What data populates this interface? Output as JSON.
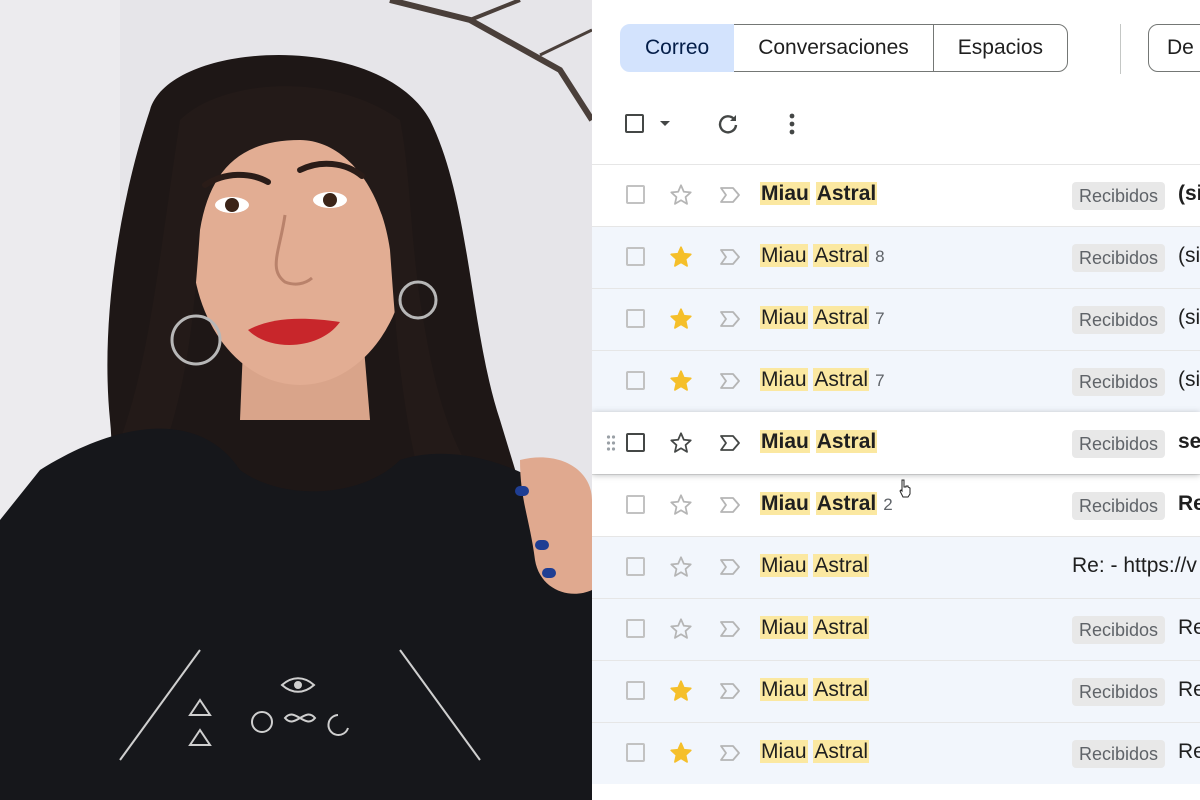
{
  "filters": {
    "tabs": [
      {
        "label": "Correo",
        "selected": true
      },
      {
        "label": "Conversaciones",
        "selected": false
      },
      {
        "label": "Espacios",
        "selected": false
      }
    ],
    "from_label": "De"
  },
  "toolbar": {
    "select_all_icon": "checkbox-icon",
    "select_menu_icon": "caret-down-icon",
    "refresh_icon": "refresh-icon",
    "more_icon": "more-vert-icon"
  },
  "emails": [
    {
      "sender_first": "Miau",
      "sender_second": "Astral",
      "count": "",
      "label": "Recibidos",
      "subject": "(si",
      "starred": false,
      "unread": true
    },
    {
      "sender_first": "Miau",
      "sender_second": "Astral",
      "count": "8",
      "label": "Recibidos",
      "subject": "(si",
      "starred": true,
      "unread": false
    },
    {
      "sender_first": "Miau",
      "sender_second": "Astral",
      "count": "7",
      "label": "Recibidos",
      "subject": "(si",
      "starred": true,
      "unread": false
    },
    {
      "sender_first": "Miau",
      "sender_second": "Astral",
      "count": "7",
      "label": "Recibidos",
      "subject": "(si",
      "starred": true,
      "unread": false
    },
    {
      "sender_first": "Miau",
      "sender_second": "Astral",
      "count": "",
      "label": "Recibidos",
      "subject": "se",
      "starred": false,
      "unread": true,
      "hovered": true
    },
    {
      "sender_first": "Miau",
      "sender_second": "Astral",
      "count": "2",
      "label": "Recibidos",
      "subject": "Re",
      "starred": false,
      "unread": true
    },
    {
      "sender_first": "Miau",
      "sender_second": "Astral",
      "count": "",
      "label": "",
      "subject": "Re: - https://v",
      "starred": false,
      "unread": false
    },
    {
      "sender_first": "Miau",
      "sender_second": "Astral",
      "count": "",
      "label": "Recibidos",
      "subject": "Re",
      "starred": false,
      "unread": false
    },
    {
      "sender_first": "Miau",
      "sender_second": "Astral",
      "count": "",
      "label": "Recibidos",
      "subject": "Re",
      "starred": true,
      "unread": false
    },
    {
      "sender_first": "Miau",
      "sender_second": "Astral",
      "count": "",
      "label": "Recibidos",
      "subject": "Re",
      "starred": true,
      "unread": false
    }
  ],
  "colors": {
    "star_on": "#f5bf2a",
    "highlight": "#fbe8a1",
    "chip_selected": "#d3e3fd"
  }
}
